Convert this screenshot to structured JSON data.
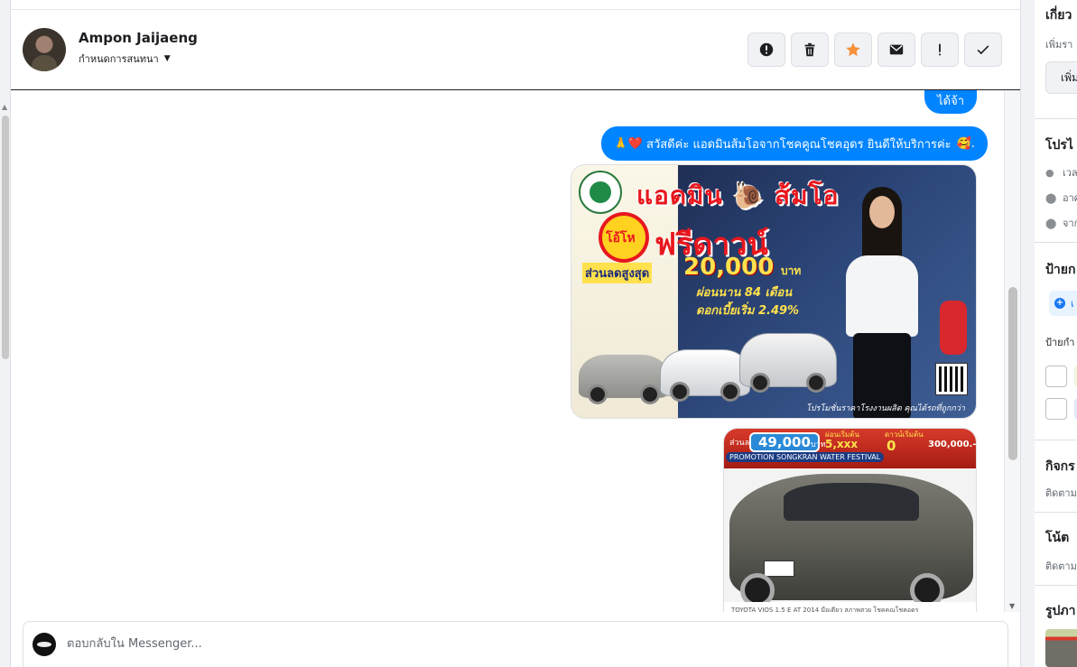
{
  "header": {
    "contact_name": "Ampon Jaijaeng",
    "assign_label": "กำหนดการสนทนา"
  },
  "toolbar": {
    "buttons": [
      {
        "name": "spam",
        "icon": "alert-circle-icon"
      },
      {
        "name": "delete",
        "icon": "trash-icon"
      },
      {
        "name": "star",
        "icon": "star-icon",
        "color": "#f7923a"
      },
      {
        "name": "mark-unread",
        "icon": "envelope-icon"
      },
      {
        "name": "follow-up",
        "icon": "exclamation-icon"
      },
      {
        "name": "done",
        "icon": "check-icon"
      }
    ]
  },
  "messages": {
    "ok_reply": "ได้จ้า",
    "greeting_prefix_emoji": "🙏❤️",
    "greeting_text": "สวัสดีค่ะ แอดมินส้มโอจากโชคคูณโชคอุดร ยินดีให้บริการค่ะ",
    "greeting_suffix_emoji": "🥰.",
    "bubble_color": "#0084ff"
  },
  "promo1": {
    "title": "แอดมิน 🐌 ส้มโอ",
    "burst": "โอ้โห",
    "free_down": "ฟรีดาวน์",
    "discount_label": "ส่วนลดสูงสุด",
    "amount": "20,000",
    "baht": "บาท",
    "installment": "ผ่อนนาน 84 เดือน",
    "rate": "ดอกเบี้ยเริ่ม 2.49%",
    "footer": "โปรโมชั่นราคาโรงงานผลิต คุณได้รถที่ถูกกว่า"
  },
  "promo2": {
    "discount_label": "ส่วนลด",
    "discount": "49,000",
    "baht": "บาท",
    "installment_label": "ผ่อนเริ่มต้น",
    "installment": "5,xxx",
    "down_label": "ดาวน์เริ่มต้น",
    "down": "0",
    "price": "300,000.-",
    "badge": "PROMOTION SONGKRAN WATER FESTIVAL",
    "footer": "TOYOTA VIOS 1.5 E AT 2014 มือเดียว สภาพสวย โชคคูณโชคอุดร"
  },
  "composer": {
    "placeholder": "ตอบกลับใน Messenger..."
  },
  "right_panel": {
    "about_title": "เกี่ยว",
    "about_sub": "เพิ่มรา",
    "about_btn": "เพิ่ม",
    "profile_title": "โปรไ",
    "profile_rows": [
      "เวล",
      "อาศ",
      "จาก"
    ],
    "labels_title": "ป้ายก",
    "labels_chip": "เ",
    "labels_sub": "ป้ายกำ",
    "activity_title": "กิจกร",
    "activity_sub": "ติดตาม",
    "notes_title": "โน้ต",
    "notes_sub": "ติดตาม",
    "photos_title": "รูปภา"
  }
}
